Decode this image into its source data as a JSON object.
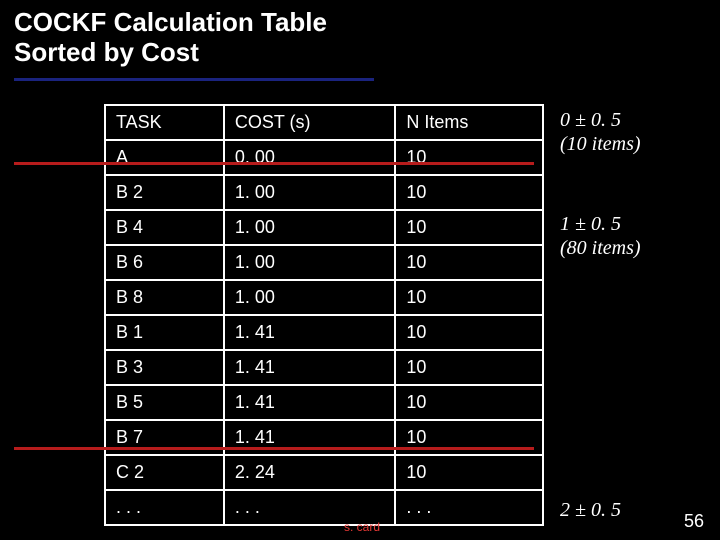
{
  "title": {
    "line1": "COCKF Calculation Table",
    "line2": "Sorted by Cost"
  },
  "table": {
    "headers": [
      "TASK",
      "COST (s)",
      "N Items"
    ],
    "rows": [
      {
        "task": "A",
        "cost": "0. 00",
        "items": "10"
      },
      {
        "task": "B 2",
        "cost": "1. 00",
        "items": "10"
      },
      {
        "task": "B 4",
        "cost": "1. 00",
        "items": "10"
      },
      {
        "task": "B 6",
        "cost": "1. 00",
        "items": "10"
      },
      {
        "task": "B 8",
        "cost": "1. 00",
        "items": "10"
      },
      {
        "task": "B 1",
        "cost": "1. 41",
        "items": "10"
      },
      {
        "task": "B 3",
        "cost": "1. 41",
        "items": "10"
      },
      {
        "task": "B 5",
        "cost": "1. 41",
        "items": "10"
      },
      {
        "task": "B 7",
        "cost": "1. 41",
        "items": "10"
      },
      {
        "task": "C 2",
        "cost": "2. 24",
        "items": "10"
      },
      {
        "task": ". . .",
        "cost": ". . .",
        "items": ". . ."
      }
    ]
  },
  "annotations": {
    "top": {
      "line1": "0 ± 0. 5",
      "line2": "(10 items)"
    },
    "mid": {
      "line1": "1 ± 0. 5",
      "line2": "(80 items)"
    },
    "bottom": "2 ± 0. 5"
  },
  "footer": {
    "credit": "s. card",
    "page": "56"
  },
  "colors": {
    "background": "#000000",
    "text": "#ffffff",
    "title_underline": "#1a237e",
    "rules": "#b71c1c",
    "credit": "#e53935"
  }
}
